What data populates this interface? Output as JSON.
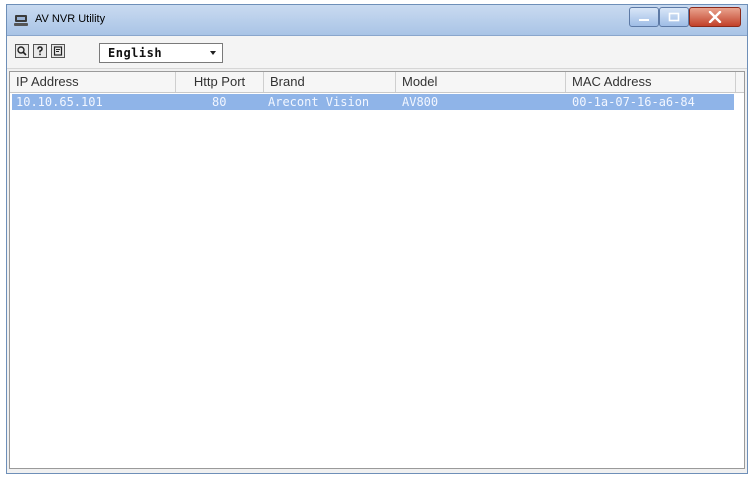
{
  "window": {
    "title": "AV NVR Utility"
  },
  "toolbar": {
    "icons": [
      "search-icon",
      "help-icon",
      "info-icon"
    ],
    "language": {
      "selected": "English"
    }
  },
  "table": {
    "columns": [
      "IP Address",
      "Http Port",
      "Brand",
      "Model",
      "MAC Address"
    ],
    "rows": [
      {
        "ip": "10.10.65.101",
        "port": "80",
        "brand": "Arecont Vision",
        "model": "AV800",
        "mac": "00-1a-07-16-a6-84"
      }
    ]
  },
  "colors": {
    "selection": "#8fb4e8",
    "title_bar": "#b7cfee",
    "close_button": "#c2412a"
  }
}
